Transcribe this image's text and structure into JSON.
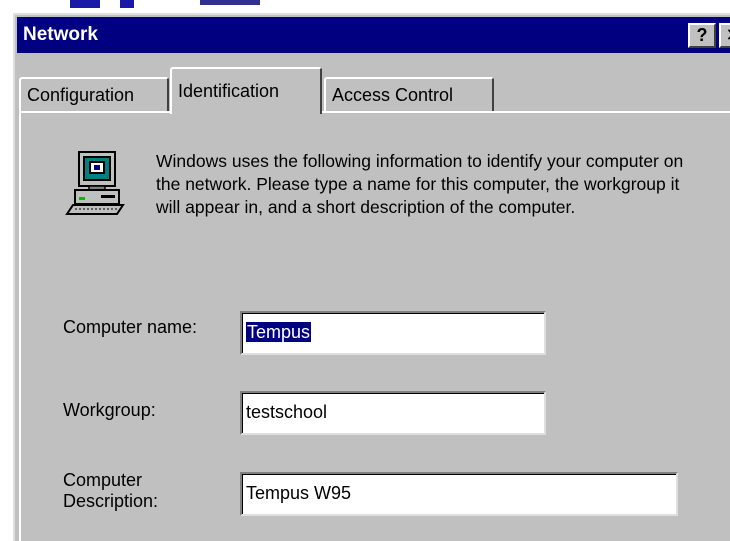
{
  "window": {
    "title": "Network",
    "help_button": "?",
    "close_button": "✕"
  },
  "tabs": [
    {
      "label": "Configuration"
    },
    {
      "label": "Identification",
      "selected": true
    },
    {
      "label": "Access Control"
    }
  ],
  "info": {
    "icon": "computer-icon",
    "text": "Windows uses the following information to identify your computer on the network.  Please type a name for this computer, the workgroup it will appear in, and a short description of the computer."
  },
  "form": {
    "computer_name": {
      "label": "Computer name:",
      "value": "Tempus"
    },
    "workgroup": {
      "label": "Workgroup:",
      "value": "testschool"
    },
    "description": {
      "label_line1": "Computer",
      "label_line2": "Description:",
      "value": "Tempus W95"
    }
  },
  "colors": {
    "titlebar": "#000080",
    "face": "#c0c0c0",
    "selection": "#000080"
  }
}
